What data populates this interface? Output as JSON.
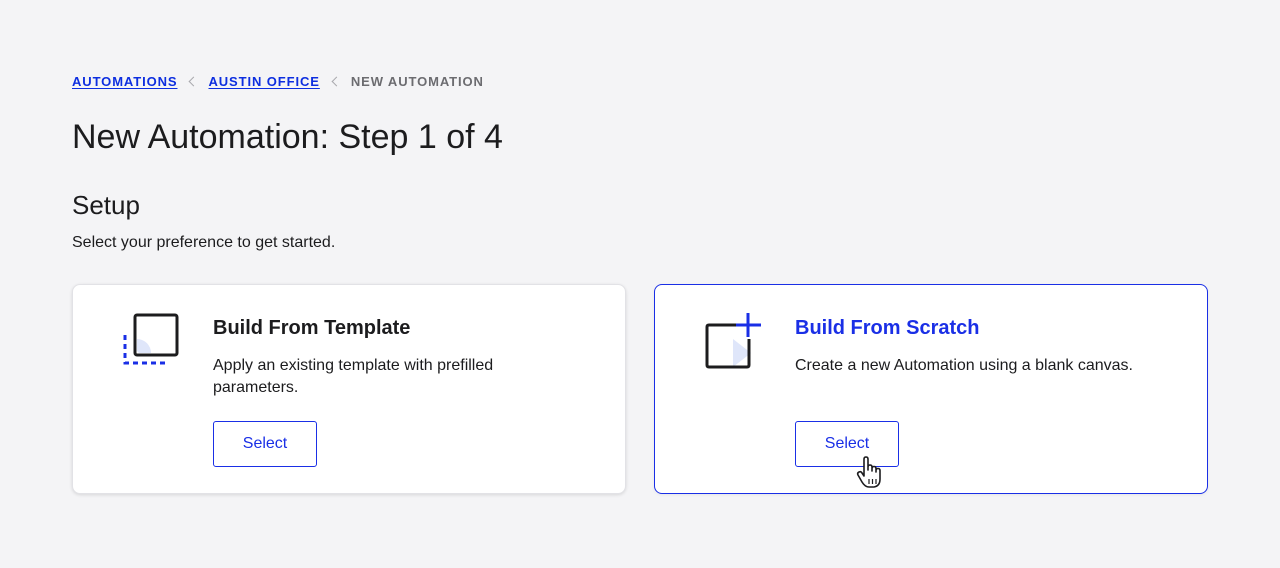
{
  "breadcrumb": {
    "items": [
      "AUTOMATIONS",
      "AUSTIN OFFICE"
    ],
    "current": "NEW AUTOMATION"
  },
  "page": {
    "title": "New Automation: Step 1 of 4"
  },
  "setup": {
    "title": "Setup",
    "subtitle": "Select your preference to get started."
  },
  "options": [
    {
      "title": "Build From Template",
      "description": "Apply an existing template with prefilled parameters.",
      "button": "Select",
      "icon": "template-icon"
    },
    {
      "title": "Build From Scratch",
      "description": "Create a new Automation using a blank canvas.",
      "button": "Select",
      "icon": "blank-canvas-plus-icon"
    }
  ],
  "colors": {
    "accent": "#1a2fe6",
    "background": "#f4f4f6",
    "icon_fill": "#dfe6fa"
  }
}
